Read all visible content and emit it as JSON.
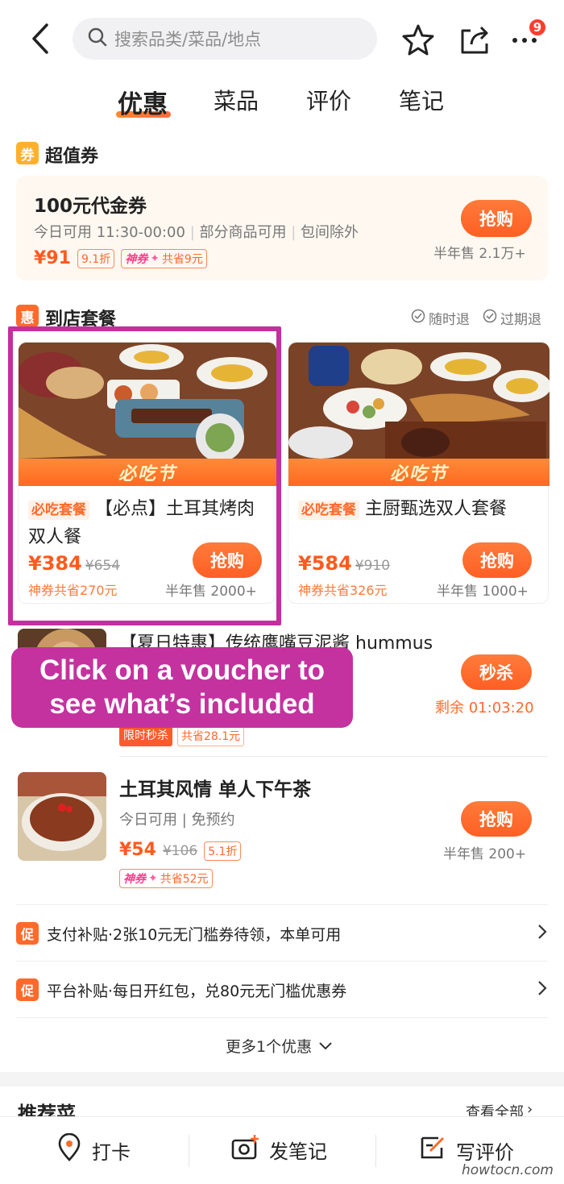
{
  "header": {
    "search_placeholder": "搜索品类/菜品/地点",
    "more_badge": "9"
  },
  "tabs": [
    {
      "label": "优惠"
    },
    {
      "label": "菜品"
    },
    {
      "label": "评价"
    },
    {
      "label": "笔记"
    }
  ],
  "voucher_section": {
    "icon": "券",
    "title": "超值券",
    "card": {
      "title": "100元代金券",
      "detail1": "今日可用 11:30-00:00",
      "detail2": "部分商品可用",
      "detail3": "包间除外",
      "price": "¥91",
      "discount": "9.1折",
      "shenquan": "神券",
      "save": "共省9元",
      "button": "抢购",
      "sold": "半年售 2.1万+"
    }
  },
  "package_section": {
    "icon": "惠",
    "title": "到店套餐",
    "refund_anytime": "随时退",
    "refund_expired": "过期退",
    "cards": [
      {
        "festival": "必吃节",
        "badge": "必吃套餐",
        "title": "【必点】土耳其烤肉双人餐",
        "price": "¥384",
        "orig": "¥654",
        "save": "神券共省270元",
        "button": "抢购",
        "sold": "半年售 2000+"
      },
      {
        "festival": "必吃节",
        "badge": "必吃套餐",
        "title": "主厨甄选双人套餐",
        "price": "¥584",
        "orig": "¥910",
        "save": "神券共省326元",
        "button": "抢购",
        "sold": "半年售 1000+"
      }
    ]
  },
  "list_items": [
    {
      "title": "【夏日特惠】传统鹰嘴豆泥酱 hummus",
      "button": "秒杀",
      "remaining": "剩余 01:03:20",
      "tag1": "限时秒杀",
      "tag2": "共省28.1元"
    },
    {
      "title": "土耳其风情 单人下午茶",
      "detail": "今日可用 | 免预约",
      "price": "¥54",
      "orig": "¥106",
      "discount": "5.1折",
      "shenquan": "神券",
      "save": "共省52元",
      "button": "抢购",
      "sold": "半年售 200+"
    }
  ],
  "callout": {
    "line1": "Click on a voucher to",
    "line2": "see what’s included"
  },
  "promos": [
    {
      "tag": "促",
      "text": "支付补贴·2张10元无门槛券待领，本单可用"
    },
    {
      "tag": "促",
      "text": "平台补贴·每日开红包，兑80元无门槛优惠券"
    }
  ],
  "more_offers": "更多1个优惠",
  "recommended": {
    "title": "推荐菜",
    "view_all": "查看全部"
  },
  "bottom_bar": {
    "checkin": "打卡",
    "post_note": "发笔记",
    "write_review": "写评价"
  },
  "watermark": "howtocn.com",
  "colors": {
    "accent": "#ff6a2b",
    "highlight": "#c4329f"
  }
}
